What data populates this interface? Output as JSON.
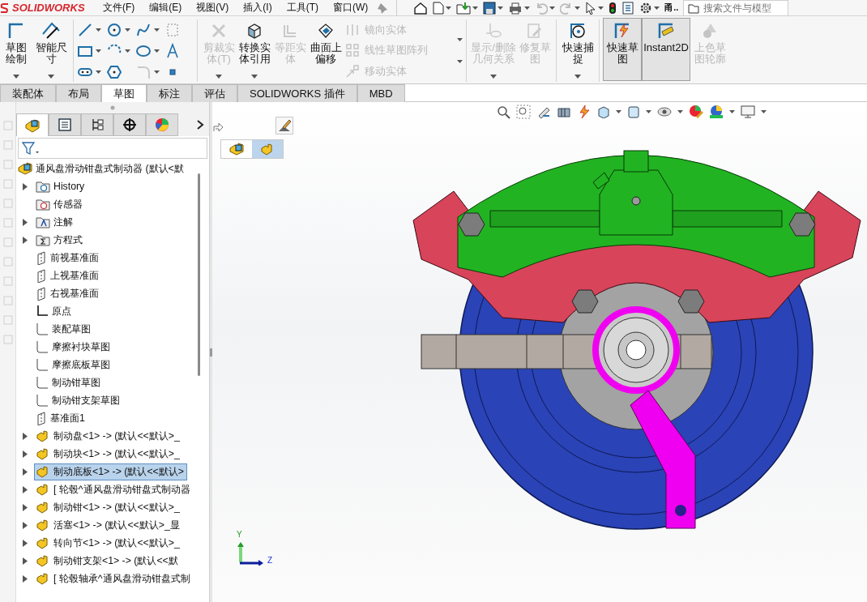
{
  "app": {
    "logo": "SOLIDWORKS",
    "menu": [
      "文件(F)",
      "编辑(E)",
      "视图(V)",
      "插入(I)",
      "工具(T)",
      "窗口(W)"
    ],
    "user_label": "甬..",
    "search": {
      "placeholder": "搜索文件与模型"
    }
  },
  "ribbon": {
    "sketch": [
      {
        "label": "草图绘制",
        "disabled": false,
        "dropdown": true
      },
      {
        "label": "智能尺寸",
        "disabled": false,
        "dropdown": true
      }
    ],
    "entities": [
      {
        "label": "剪裁实体(T)",
        "disabled": true,
        "dropdown": true
      },
      {
        "label": "转换实体引用",
        "disabled": false,
        "dropdown": true
      },
      {
        "label": "等距实体",
        "disabled": true,
        "dropdown": false
      },
      {
        "label": "曲面上偏移",
        "disabled": false,
        "dropdown": false
      }
    ],
    "small": [
      {
        "label": "镜向实体",
        "disabled": true
      },
      {
        "label": "线性草图阵列",
        "disabled": true
      },
      {
        "label": "移动实体",
        "disabled": true
      }
    ],
    "relations": [
      {
        "label": "显示/删除几何关系",
        "disabled": true,
        "dropdown": true
      },
      {
        "label": "修复草图",
        "disabled": true,
        "dropdown": false
      }
    ],
    "snap": [
      {
        "label": "快速捕捉",
        "disabled": false,
        "dropdown": true
      }
    ],
    "modes": [
      {
        "label": "快速草图",
        "disabled": false,
        "selected": true
      },
      {
        "label": "Instant2D",
        "disabled": false,
        "selected": true
      },
      {
        "label": "上色草图轮廓",
        "disabled": true,
        "selected": false
      }
    ]
  },
  "tabs": [
    {
      "label": "装配体",
      "selected": false
    },
    {
      "label": "布局",
      "selected": false
    },
    {
      "label": "草图",
      "selected": true
    },
    {
      "label": "标注",
      "selected": false
    },
    {
      "label": "评估",
      "selected": false
    },
    {
      "label": "SOLIDWORKS 插件",
      "selected": false
    },
    {
      "label": "MBD",
      "selected": false
    }
  ],
  "panel_tabs": [
    {
      "selected": true
    },
    {
      "selected": false
    },
    {
      "selected": false
    },
    {
      "selected": false
    },
    {
      "selected": false
    }
  ],
  "tree": {
    "root": {
      "label": "通风盘滑动钳盘式制动器 (默认<默"
    },
    "items": [
      {
        "label": "History",
        "kind": "history",
        "expandable": true,
        "selected": false
      },
      {
        "label": "传感器",
        "kind": "sensors",
        "expandable": false,
        "selected": false
      },
      {
        "label": "注解",
        "kind": "annotations",
        "expandable": true,
        "selected": false
      },
      {
        "label": "方程式",
        "kind": "equations",
        "expandable": true,
        "selected": false
      },
      {
        "label": "前视基准面",
        "kind": "plane",
        "expandable": false,
        "selected": false
      },
      {
        "label": "上视基准面",
        "kind": "plane",
        "expandable": false,
        "selected": false
      },
      {
        "label": "右视基准面",
        "kind": "plane",
        "expandable": false,
        "selected": false
      },
      {
        "label": "原点",
        "kind": "origin",
        "expandable": false,
        "selected": false
      },
      {
        "label": "装配草图",
        "kind": "sketch",
        "expandable": false,
        "selected": false
      },
      {
        "label": "摩擦衬块草图",
        "kind": "sketch",
        "expandable": false,
        "selected": false
      },
      {
        "label": "摩擦底板草图",
        "kind": "sketch",
        "expandable": false,
        "selected": false
      },
      {
        "label": "制动钳草图",
        "kind": "sketch",
        "expandable": false,
        "selected": false
      },
      {
        "label": "制动钳支架草图",
        "kind": "sketch",
        "expandable": false,
        "selected": false
      },
      {
        "label": "基准面1",
        "kind": "plane",
        "expandable": false,
        "selected": false
      },
      {
        "label": "制动盘<1> -> (默认<<默认>_",
        "kind": "part",
        "expandable": true,
        "selected": false
      },
      {
        "label": "制动块<1> -> (默认<<默认>_",
        "kind": "part",
        "expandable": true,
        "selected": false
      },
      {
        "label": "制动底板<1> -> (默认<<默认>",
        "kind": "part",
        "expandable": true,
        "selected": true
      },
      {
        "label": "[ 轮毂^通风盘滑动钳盘式制动器",
        "kind": "part",
        "expandable": true,
        "selected": false
      },
      {
        "label": "制动钳<1> -> (默认<<默认>_",
        "kind": "part",
        "expandable": true,
        "selected": false
      },
      {
        "label": "活塞<1> -> (默认<<默认>_显",
        "kind": "part",
        "expandable": true,
        "selected": false
      },
      {
        "label": "转向节<1> -> (默认<<默认>_",
        "kind": "part",
        "expandable": true,
        "selected": false
      },
      {
        "label": "制动钳支架<1> -> (默认<<默",
        "kind": "part",
        "expandable": true,
        "selected": false
      },
      {
        "label": "[ 轮毂轴承^通风盘滑动钳盘式制",
        "kind": "part",
        "expandable": true,
        "selected": false
      }
    ]
  },
  "canvas": {
    "breadcrumb": [
      {
        "selected": false
      },
      {
        "selected": true
      }
    ],
    "axes": [
      "Y",
      "Z"
    ]
  }
}
